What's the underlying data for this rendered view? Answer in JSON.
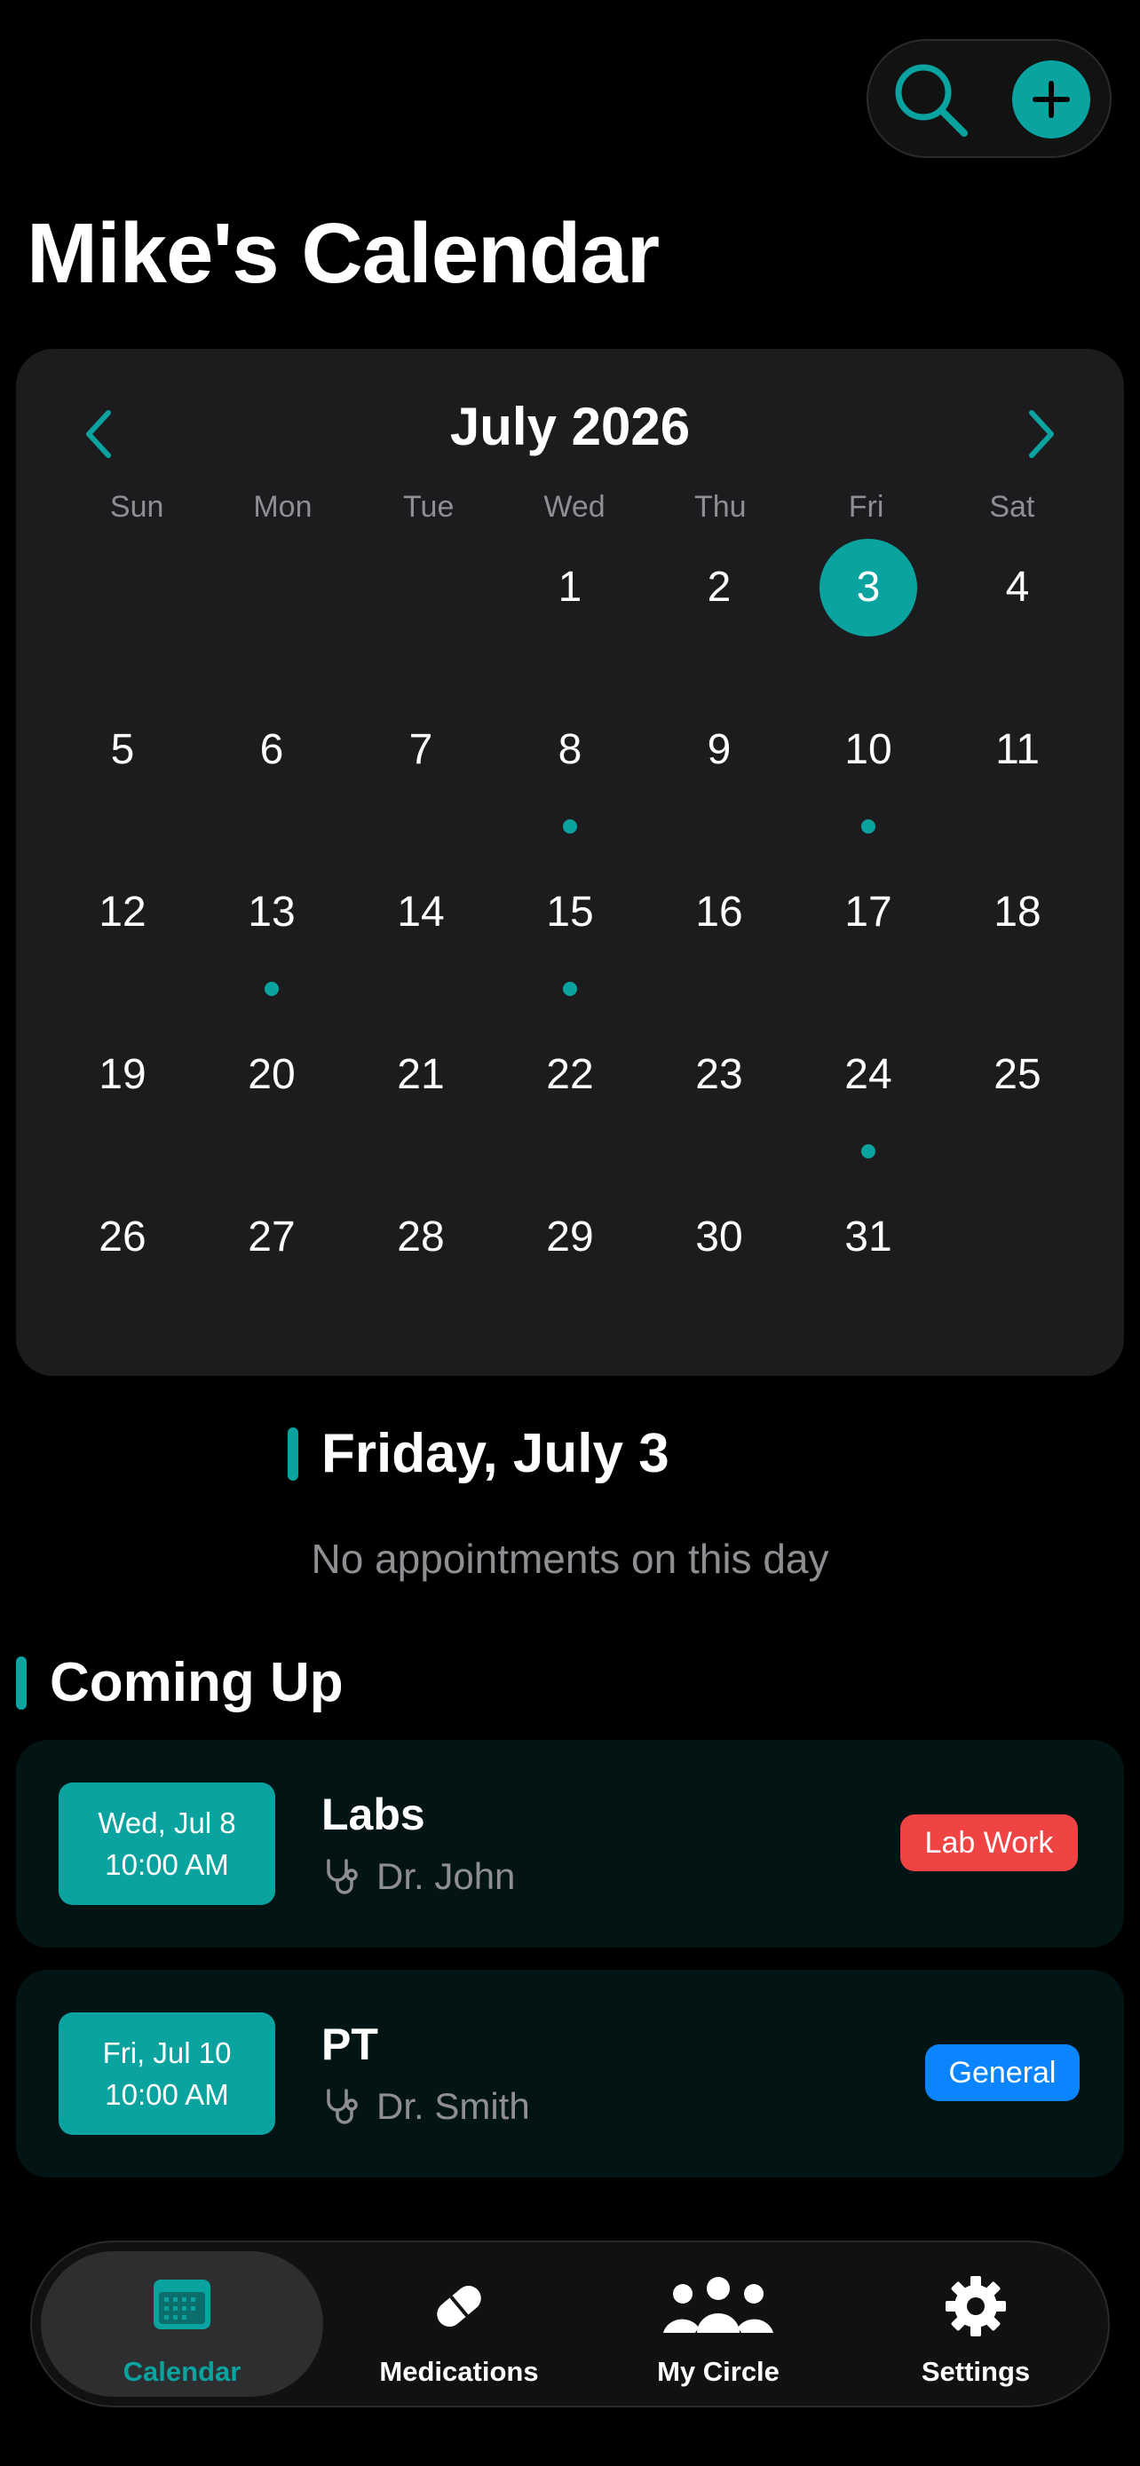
{
  "colors": {
    "accent": "#0aa3a0",
    "background": "#000000",
    "card": "#1c1c1e",
    "appointment_card": "#021414",
    "muted_text": "#8e8e93",
    "lab_work_badge": "#f04444",
    "general_badge": "#0a84ff"
  },
  "header": {
    "search_icon": "search-icon",
    "add_icon": "plus-icon",
    "title": "Mike's Calendar"
  },
  "calendar": {
    "month_title": "July 2026",
    "weekdays": [
      "Sun",
      "Mon",
      "Tue",
      "Wed",
      "Thu",
      "Fri",
      "Sat"
    ],
    "first_weekday_index": 3,
    "days_in_month": 31,
    "selected_day": 3,
    "days_with_events": [
      8,
      10,
      13,
      15,
      24
    ]
  },
  "selected_date": {
    "label": "Friday, July 3",
    "empty_message": "No appointments on this day"
  },
  "coming_up": {
    "title": "Coming Up",
    "appointments": [
      {
        "date": "Wed, Jul 8",
        "time": "10:00 AM",
        "title": "Labs",
        "doctor": "Dr. John",
        "badge": "Lab Work",
        "badge_color": "#f04444"
      },
      {
        "date": "Fri, Jul 10",
        "time": "10:00 AM",
        "title": "PT",
        "doctor": "Dr. Smith",
        "badge": "General",
        "badge_color": "#0a84ff"
      }
    ]
  },
  "tab_bar": {
    "active": "Calendar",
    "items": [
      {
        "label": "Calendar",
        "icon": "calendar-icon"
      },
      {
        "label": "Medications",
        "icon": "pill-icon"
      },
      {
        "label": "My Circle",
        "icon": "people-icon"
      },
      {
        "label": "Settings",
        "icon": "gear-icon"
      }
    ]
  }
}
